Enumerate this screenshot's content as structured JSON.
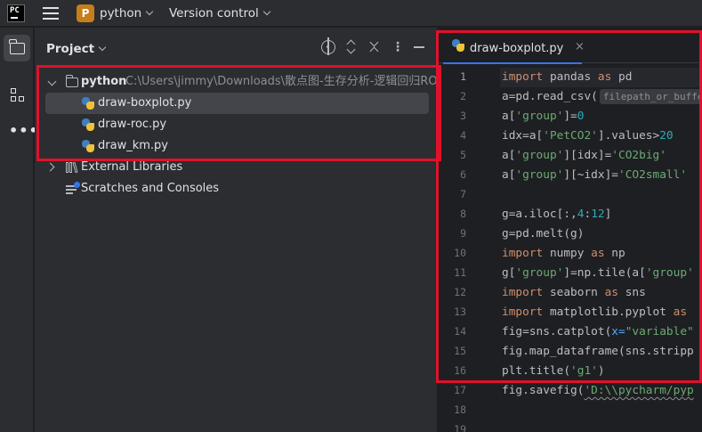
{
  "titlebar": {
    "app_logo_text": "PC",
    "project_badge": "P",
    "project_name": "python",
    "vcs_label": "Version control"
  },
  "toolstrip": {
    "items": [
      "project-tool",
      "structure-tool",
      "more-tools"
    ]
  },
  "project_panel": {
    "title": "Project",
    "root": {
      "name": "python",
      "path": "C:\\Users\\jimmy\\Downloads\\散点图-生存分析-逻辑回归ROC"
    },
    "files": [
      {
        "name": "draw-boxplot.py",
        "selected": true
      },
      {
        "name": "draw-roc.py",
        "selected": false
      },
      {
        "name": "draw_km.py",
        "selected": false
      }
    ],
    "external_libraries": "External Libraries",
    "scratches": "Scratches and Consoles"
  },
  "editor": {
    "tab_label": "draw-boxplot.py",
    "tab_close": "×",
    "line_numbers": [
      "1",
      "2",
      "3",
      "4",
      "5",
      "6",
      "7",
      "8",
      "9",
      "10",
      "11",
      "12",
      "13",
      "14",
      "15",
      "16",
      "17",
      "18",
      "19"
    ],
    "code": {
      "l1": {
        "kw1": "import",
        "t1": " pandas ",
        "kw2": "as",
        "t2": " pd"
      },
      "l2": {
        "t1": "a=pd.read_csv(",
        "hint": "filepath_or_buffer:"
      },
      "l3": {
        "t1": "a[",
        "s1": "'group'",
        "t2": "]=",
        "n1": "0"
      },
      "l4": {
        "t1": "idx=a[",
        "s1": "'PetCO2'",
        "t2": "].values>",
        "n1": "20"
      },
      "l5": {
        "t1": "a[",
        "s1": "'group'",
        "t2": "][idx]=",
        "s2": "'CO2big'"
      },
      "l6": {
        "t1": "a[",
        "s1": "'group'",
        "t2": "][~idx]=",
        "s2": "'CO2small'"
      },
      "l8": {
        "t1": "g=a.iloc[:,",
        "n1": "4",
        "t2": ":",
        "n2": "12",
        "t3": "]"
      },
      "l9": {
        "t1": "g=pd.melt(g)"
      },
      "l10": {
        "kw1": "import",
        "t1": " numpy ",
        "kw2": "as",
        "t2": " np"
      },
      "l11": {
        "t1": "g[",
        "s1": "'group'",
        "t2": "]=np.tile(a[",
        "s2": "'group'"
      },
      "l12": {
        "kw1": "import",
        "t1": " seaborn ",
        "kw2": "as",
        "t2": " sns"
      },
      "l13": {
        "kw1": "import",
        "t1": " matplotlib.pyplot ",
        "kw2": "as"
      },
      "l14": {
        "t1": "fig=sns.catplot(",
        "p1": "x=",
        "s1": "\"variable\""
      },
      "l15": {
        "t1": "fig.map_dataframe(sns.stripp"
      },
      "l16": {
        "t1": "plt.title(",
        "s1": "'g1'",
        "t2": ")"
      },
      "l17": {
        "t1": "fig.savefig(",
        "s1": "'D:\\\\pycharm/pyp"
      }
    }
  },
  "colors": {
    "highlight": "#e0112b",
    "keyword": "#cf8e6d",
    "string": "#6aab73",
    "number": "#2aacb8",
    "accent": "#3574f0"
  }
}
